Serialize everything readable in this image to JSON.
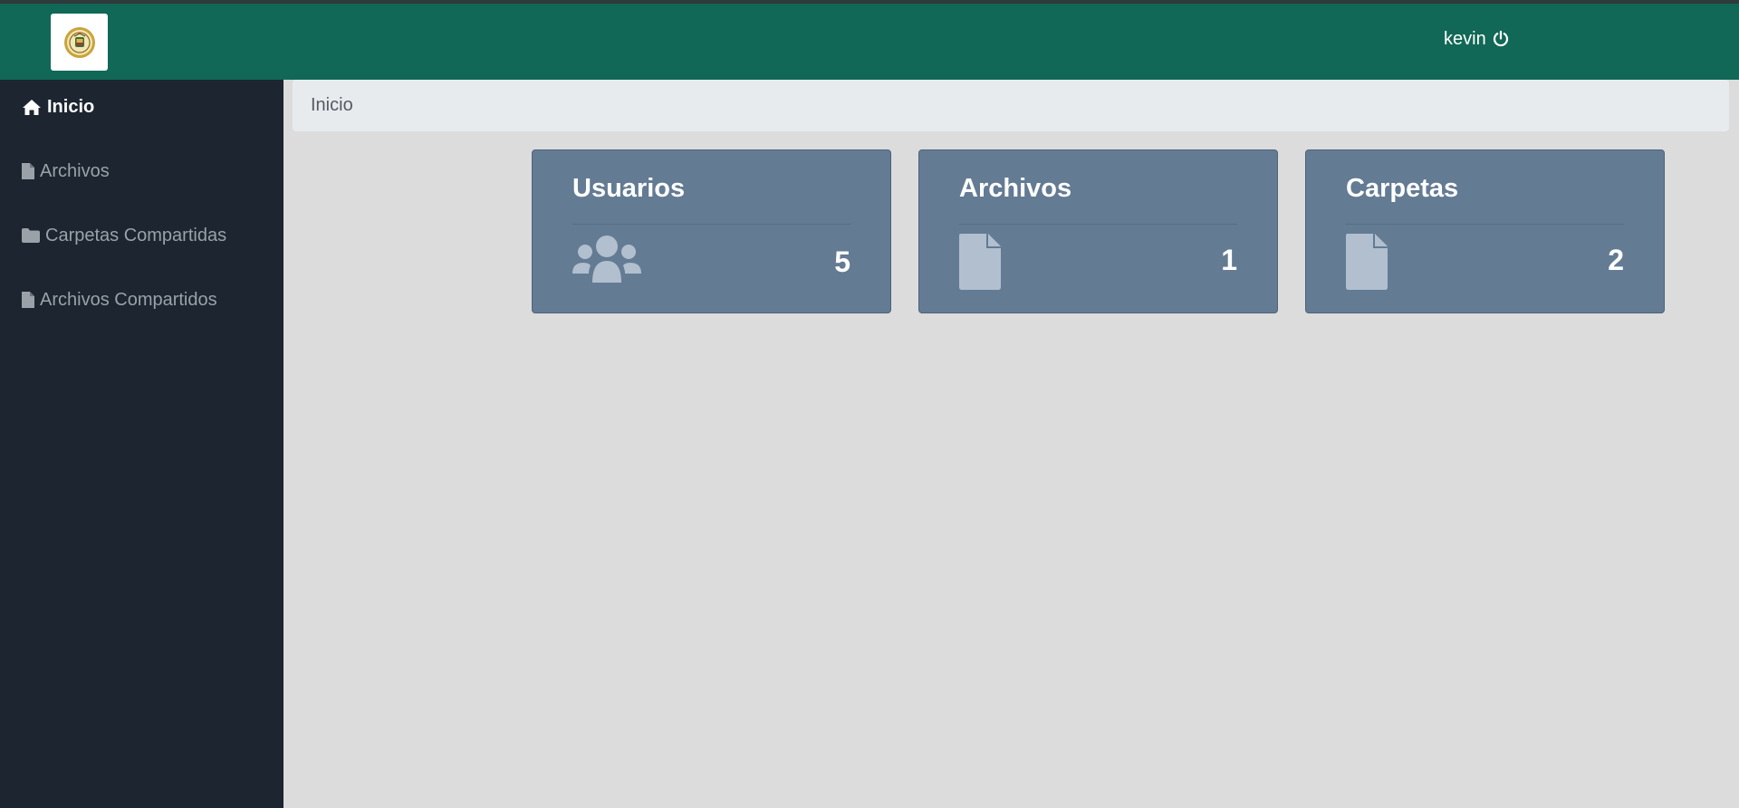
{
  "header": {
    "logo": "seal-logo",
    "username": "kevin",
    "logout_icon": "power-icon"
  },
  "sidebar": {
    "items": [
      {
        "label": "Inicio",
        "icon": "home-icon",
        "active": true
      },
      {
        "label": "Archivos",
        "icon": "file-icon",
        "active": false
      },
      {
        "label": "Carpetas Compartidas",
        "icon": "folder-icon",
        "active": false
      },
      {
        "label": "Archivos Compartidos",
        "icon": "file-icon",
        "active": false
      }
    ]
  },
  "breadcrumb": {
    "current": "Inicio"
  },
  "cards": [
    {
      "title": "Usuarios",
      "count": "5",
      "icon": "users-icon"
    },
    {
      "title": "Archivos",
      "count": "1",
      "icon": "file-icon"
    },
    {
      "title": "Carpetas",
      "count": "2",
      "icon": "file-icon"
    }
  ],
  "colors": {
    "header_bg": "#116856",
    "sidebar_bg": "#1c2530",
    "card_bg": "#637b93",
    "content_bg": "#dcdcdc"
  }
}
